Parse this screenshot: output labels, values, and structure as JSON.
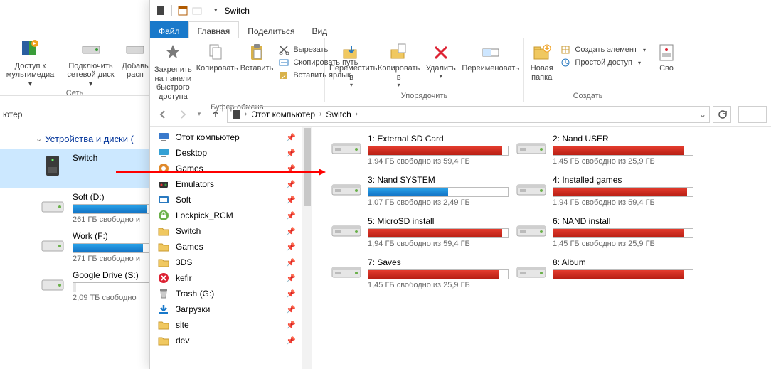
{
  "back": {
    "ribbon": {
      "media_access": "Доступ к\nмультимедиа",
      "network_drive": "Подключить\nсетевой диск",
      "add": "Добавь\nрасп",
      "footer": "Сеть"
    },
    "address_hint": "ютер",
    "section_header": "Устройства и диски (",
    "drives": [
      {
        "name": "Switch",
        "stat": "",
        "fill": 0,
        "color": "none",
        "icon": "server",
        "selected": true
      },
      {
        "name": "Soft (D:)",
        "stat": "261 ГБ свободно и",
        "fill": 55,
        "color": "blue",
        "icon": "hdd"
      },
      {
        "name": "Work (F:)",
        "stat": "271 ГБ свободно и",
        "fill": 52,
        "color": "blue",
        "icon": "hdd"
      },
      {
        "name": "Google Drive (S:)",
        "stat": "2,09 ТБ свободно",
        "fill": 2,
        "color": "gray",
        "icon": "hdd"
      }
    ]
  },
  "front": {
    "title": "Switch",
    "menu": {
      "file": "Файл",
      "home": "Главная",
      "share": "Поделиться",
      "view": "Вид"
    },
    "ribbon": {
      "pin": "Закрепить на панели\nбыстрого доступа",
      "copy": "Копировать",
      "paste": "Вставить",
      "cut": "Вырезать",
      "copy_path": "Скопировать путь",
      "paste_shortcut": "Вставить ярлык",
      "group_clipboard": "Буфер обмена",
      "move_to": "Переместить\nв",
      "copy_to": "Копировать\nв",
      "delete": "Удалить",
      "rename": "Переименовать",
      "group_organize": "Упорядочить",
      "new_folder": "Новая\nпапка",
      "new_item": "Создать элемент",
      "easy_access": "Простой доступ",
      "group_new": "Создать",
      "properties": "Сво"
    },
    "breadcrumbs_pc": "Этот компьютер",
    "breadcrumbs_switch": "Switch",
    "nav": [
      {
        "label": "Этот компьютер",
        "icon": "pc",
        "pin": true
      },
      {
        "label": "Desktop",
        "icon": "desktop",
        "pin": true
      },
      {
        "label": "Games",
        "icon": "games",
        "pin": true
      },
      {
        "label": "Emulators",
        "icon": "emulators",
        "pin": true
      },
      {
        "label": "Soft",
        "icon": "soft",
        "pin": true
      },
      {
        "label": "Lockpick_RCM",
        "icon": "lock",
        "pin": true
      },
      {
        "label": "Switch",
        "icon": "folder",
        "pin": true
      },
      {
        "label": "Games",
        "icon": "folder",
        "pin": true
      },
      {
        "label": "3DS",
        "icon": "folder",
        "pin": true
      },
      {
        "label": "kefir",
        "icon": "kefir",
        "pin": true
      },
      {
        "label": "Trash (G:)",
        "icon": "trash",
        "pin": true
      },
      {
        "label": "Загрузки",
        "icon": "downloads",
        "pin": true
      },
      {
        "label": "site",
        "icon": "folder",
        "pin": true
      },
      {
        "label": "dev",
        "icon": "folder",
        "pin": true
      }
    ],
    "drives": [
      {
        "name": "1: External SD Card",
        "stat": "1,94 ГБ свободно из 59,4 ГБ",
        "fill": 96,
        "color": "red"
      },
      {
        "name": "2: Nand USER",
        "stat": "1,45 ГБ свободно из 25,9 ГБ",
        "fill": 94,
        "color": "red"
      },
      {
        "name": "3: Nand SYSTEM",
        "stat": "1,07 ГБ свободно из 2,49 ГБ",
        "fill": 57,
        "color": "blue"
      },
      {
        "name": "4: Installed games",
        "stat": "1,94 ГБ свободно из 59,4 ГБ",
        "fill": 96,
        "color": "red"
      },
      {
        "name": "5: MicroSD install",
        "stat": "1,94 ГБ свободно из 59,4 ГБ",
        "fill": 96,
        "color": "red"
      },
      {
        "name": "6: NAND install",
        "stat": "1,45 ГБ свободно из 25,9 ГБ",
        "fill": 94,
        "color": "red"
      },
      {
        "name": "7: Saves",
        "stat": "1,45 ГБ свободно из 25,9 ГБ",
        "fill": 94,
        "color": "red"
      },
      {
        "name": "8: Album",
        "stat": "",
        "fill": 94,
        "color": "red"
      }
    ]
  }
}
